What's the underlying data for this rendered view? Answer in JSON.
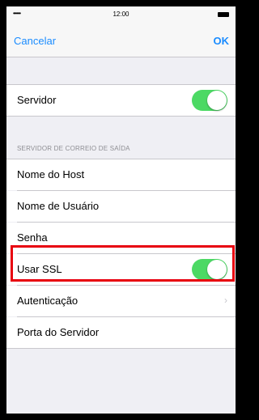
{
  "status_bar": {
    "signal": "•••••",
    "time": "12:00"
  },
  "nav": {
    "left": "Cancelar",
    "right": "OK"
  },
  "rows": [
    {
      "label": "Servidor",
      "toggle": true
    },
    {
      "label": "Nome do Host"
    },
    {
      "label": "Nome de Usuário"
    },
    {
      "label": "Senha"
    },
    {
      "label": "Usar SSL",
      "toggle": true
    },
    {
      "label": "Autenticação",
      "chevron": "›"
    },
    {
      "label": "Porta do Servidor"
    }
  ],
  "section_header": "SERVIDOR DE CORREIO DE SAÍDA",
  "colors": {
    "accent": "#1a8cff",
    "toggle_on": "#4cd964",
    "highlight_box": "#e8000f"
  }
}
